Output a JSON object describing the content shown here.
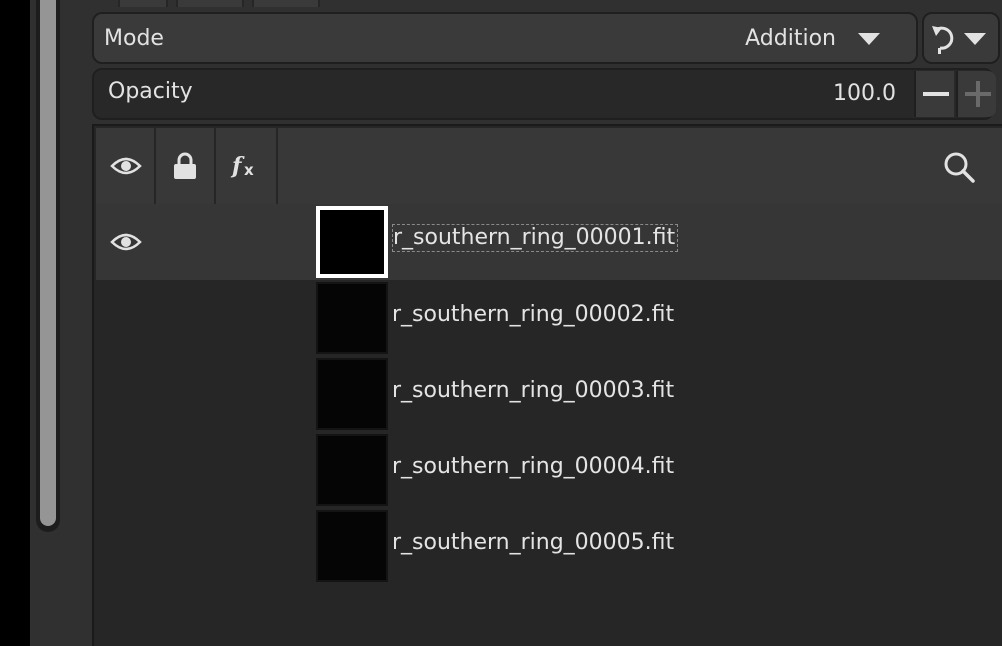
{
  "colors": {
    "panel_bg": "#262626",
    "row_selected": "#363636",
    "header_bg": "#383838",
    "text": "#e2e2e2"
  },
  "mode": {
    "label": "Mode",
    "value": "Addition",
    "dropdown_icon": "chevron-down-icon",
    "reset_icon": "reset-icon"
  },
  "opacity": {
    "label": "Opacity",
    "value": "100.0",
    "decrease_icon": "minus-icon",
    "increase_icon": "plus-icon"
  },
  "header": {
    "columns": [
      {
        "icon": "eye-icon"
      },
      {
        "icon": "lock-icon"
      },
      {
        "icon": "fx-icon"
      }
    ],
    "search_icon": "search-icon"
  },
  "layers": [
    {
      "name": "r_southern_ring_00001.fit",
      "visible": true,
      "selected": true
    },
    {
      "name": "r_southern_ring_00002.fit",
      "visible": false,
      "selected": false
    },
    {
      "name": "r_southern_ring_00003.fit",
      "visible": false,
      "selected": false
    },
    {
      "name": "r_southern_ring_00004.fit",
      "visible": false,
      "selected": false
    },
    {
      "name": "r_southern_ring_00005.fit",
      "visible": false,
      "selected": false
    }
  ]
}
